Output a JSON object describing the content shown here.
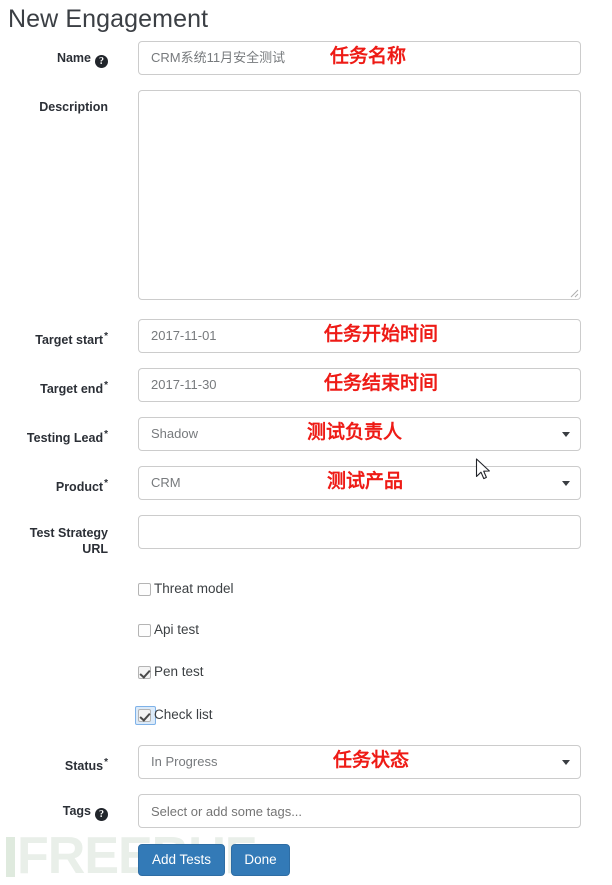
{
  "page": {
    "title": "New Engagement",
    "watermark": "FREEBUF"
  },
  "fields": {
    "name": {
      "label": "Name",
      "help_icon": "question-mark-icon",
      "value": "CRM系统11月安全测试",
      "annotation": "任务名称"
    },
    "description": {
      "label": "Description",
      "value": ""
    },
    "target_start": {
      "label": "Target start",
      "required": "*",
      "value": "2017-11-01",
      "annotation": "任务开始时间"
    },
    "target_end": {
      "label": "Target end",
      "required": "*",
      "value": "2017-11-30",
      "annotation": "任务结束时间"
    },
    "testing_lead": {
      "label": "Testing Lead",
      "required": "*",
      "value": "Shadow",
      "annotation": "测试负责人"
    },
    "product": {
      "label": "Product",
      "required": "*",
      "value": "CRM",
      "annotation": "测试产品"
    },
    "test_strategy_url": {
      "label_line1": "Test Strategy",
      "label_line2": "URL",
      "value": ""
    },
    "status": {
      "label": "Status",
      "required": "*",
      "value": "In Progress",
      "annotation": "任务状态"
    },
    "tags": {
      "label": "Tags",
      "help_icon": "question-mark-icon",
      "value": "",
      "placeholder": "Select or add some tags..."
    }
  },
  "checkboxes": [
    {
      "label": "Threat model",
      "checked": false,
      "focused": false
    },
    {
      "label": "Api test",
      "checked": false,
      "focused": false
    },
    {
      "label": "Pen test",
      "checked": true,
      "focused": false
    },
    {
      "label": "Check list",
      "checked": true,
      "focused": true
    }
  ],
  "buttons": {
    "add_tests": "Add Tests",
    "done": "Done"
  },
  "colors": {
    "primary_button": "#337ab7",
    "annotation_red": "#ee1b16",
    "border": "#cccccc",
    "label_text": "#2b2f36"
  }
}
